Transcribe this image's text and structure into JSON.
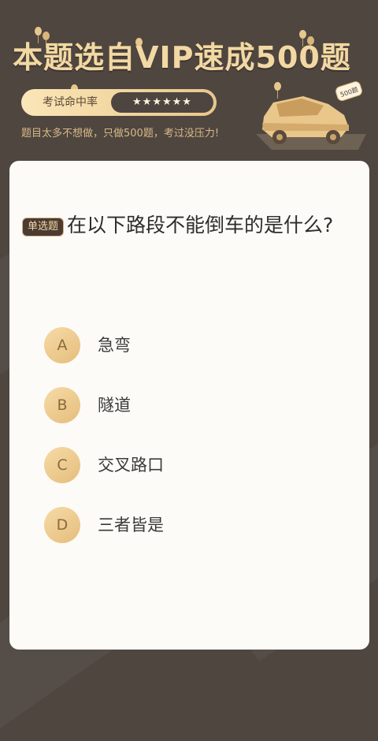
{
  "header": {
    "title": "本题选自VIP速成500题",
    "rate_label": "考试命中率",
    "rate_stars": "★★★★★★",
    "rate_star_count": 6,
    "subtitle": "题目太多不想做，只做500题，考过没压力!",
    "car_badge": "500题"
  },
  "question": {
    "type_label": "单选题",
    "text": "在以下路段不能倒车的是什么?",
    "options": [
      {
        "letter": "A",
        "text": "急弯"
      },
      {
        "letter": "B",
        "text": "隧道"
      },
      {
        "letter": "C",
        "text": "交叉路口"
      },
      {
        "letter": "D",
        "text": "三者皆是"
      }
    ]
  },
  "colors": {
    "background": "#4f4640",
    "accent_gold": "#e5bd7c",
    "title_gold": "#f2d8a2",
    "card": "#fdfbf7"
  },
  "icons": [
    "balloon-icon",
    "star-icon",
    "car-icon"
  ]
}
